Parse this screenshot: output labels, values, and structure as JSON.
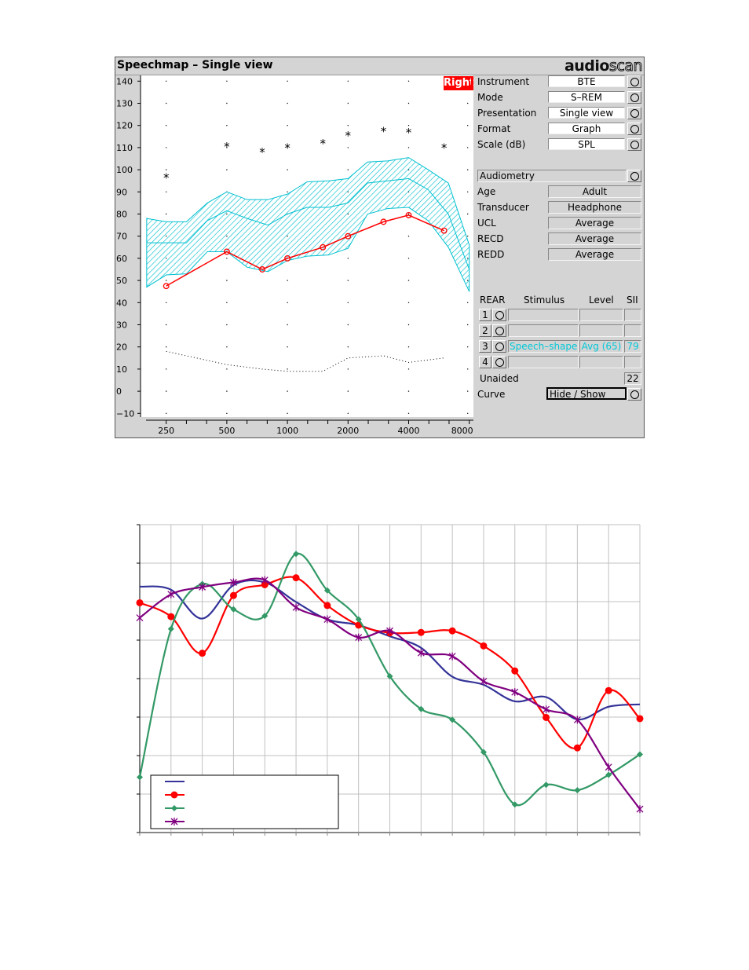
{
  "speechmap": {
    "title": "Speechmap – Single view",
    "brand_left": "audio",
    "brand_right": "scan",
    "ear_badge": "Right",
    "settings": [
      {
        "label": "Instrument",
        "value": "BTE"
      },
      {
        "label": "Mode",
        "value": "S–REM"
      },
      {
        "label": "Presentation",
        "value": "Single view"
      },
      {
        "label": "Format",
        "value": "Graph"
      },
      {
        "label": "Scale (dB)",
        "value": "SPL"
      }
    ],
    "audiometry": {
      "button": "Audiometry",
      "rows": [
        {
          "label": "Age",
          "value": "Adult"
        },
        {
          "label": "Transducer",
          "value": "Headphone"
        },
        {
          "label": "UCL",
          "value": "Average"
        },
        {
          "label": "RECD",
          "value": "Average"
        },
        {
          "label": "REDD",
          "value": "Average"
        }
      ]
    },
    "rear": {
      "headers": [
        "REAR",
        "Stimulus",
        "Level",
        "SII"
      ],
      "rows": [
        {
          "num": "1",
          "stimulus": "",
          "level": "",
          "sii": ""
        },
        {
          "num": "2",
          "stimulus": "",
          "level": "",
          "sii": ""
        },
        {
          "num": "3",
          "stimulus": "Speech–shape",
          "level": "Avg (65)",
          "sii": "79"
        },
        {
          "num": "4",
          "stimulus": "",
          "level": "",
          "sii": ""
        }
      ],
      "unaided_label": "Unaided",
      "unaided_value": "22",
      "curve_label": "Curve",
      "curve_button": "Hide / Show"
    },
    "colors": {
      "ear": "#ff0000",
      "speech_band": "#00c0d0",
      "aided": "#ff0000"
    }
  },
  "chart_data": [
    {
      "type": "line",
      "xscale": "log",
      "xlim": [
        200,
        8000
      ],
      "ylim": [
        -10,
        140
      ],
      "ylabel": "",
      "xlabel": "",
      "y_ticks": [
        "140",
        "130",
        "120",
        "110",
        "100",
        "90",
        "80",
        "70",
        "60",
        "50",
        "40",
        "30",
        "20",
        "10",
        "0",
        "−10"
      ],
      "x_ticks": [
        "250",
        "500",
        "1000",
        "2000",
        "4000",
        "8000"
      ],
      "grid": "dots",
      "aided_output": {
        "x": [
          250,
          500,
          750,
          1000,
          1500,
          2000,
          3000,
          4000,
          6000
        ],
        "y": [
          47.5,
          63,
          55,
          60,
          65,
          70,
          76.5,
          79.5,
          72.5
        ]
      },
      "ucl": {
        "x": [
          250,
          500,
          750,
          1000,
          1500,
          2000,
          3000,
          4000,
          6000
        ],
        "y": [
          97,
          111,
          108.5,
          110.5,
          112.5,
          116,
          118,
          117.5,
          110.5
        ]
      },
      "threshold": {
        "x": [
          250,
          500,
          750,
          1000,
          1500,
          2000,
          3000,
          4000,
          6000
        ],
        "y": [
          18,
          12,
          10,
          9,
          9,
          15,
          16,
          13,
          15
        ]
      },
      "speech_band": {
        "x": [
          200,
          250,
          315,
          400,
          500,
          630,
          800,
          1000,
          1250,
          1600,
          2000,
          2500,
          3150,
          4000,
          5000,
          6300,
          8000
        ],
        "upper": [
          78,
          76.5,
          76.5,
          85,
          90,
          86.5,
          86.5,
          89,
          94.5,
          95,
          96,
          103.5,
          104,
          105.5,
          100,
          94,
          66
        ],
        "middle": [
          67,
          67,
          67,
          77,
          81.5,
          78,
          75,
          80,
          83,
          83,
          85,
          94,
          95,
          96,
          91,
          80,
          55
        ],
        "lower": [
          47,
          52.5,
          53,
          63,
          63,
          56,
          54,
          59,
          61,
          61.5,
          64.5,
          80,
          82.5,
          83,
          77,
          65,
          45
        ]
      }
    },
    {
      "type": "line",
      "x": [
        0,
        1,
        2,
        3,
        4,
        5,
        6,
        7,
        8,
        9,
        10,
        11,
        12,
        13,
        14,
        15,
        16
      ],
      "ylim": [
        0,
        8
      ],
      "grid": true,
      "legend": "bottom-left",
      "series": [
        {
          "color": "#333399",
          "marker": "none",
          "values": [
            6.39,
            6.31,
            5.56,
            6.43,
            6.5,
            5.99,
            5.54,
            5.39,
            5.1,
            4.8,
            4.05,
            3.84,
            3.41,
            3.52,
            2.94,
            3.27,
            3.33
          ]
        },
        {
          "color": "#ff0000",
          "marker": "circle",
          "values": [
            5.97,
            5.61,
            4.66,
            6.16,
            6.44,
            6.62,
            5.9,
            5.39,
            5.19,
            5.2,
            5.24,
            4.85,
            4.2,
            2.99,
            2.2,
            3.69,
            2.96
          ]
        },
        {
          "color": "#339966",
          "marker": "diamond",
          "values": [
            1.44,
            5.29,
            6.46,
            5.8,
            5.63,
            7.24,
            6.29,
            5.54,
            4.06,
            3.21,
            2.93,
            2.09,
            0.73,
            1.24,
            1.1,
            1.5,
            2.03
          ]
        },
        {
          "color": "#800080",
          "marker": "asterisk",
          "values": [
            5.58,
            6.19,
            6.38,
            6.5,
            6.56,
            5.85,
            5.54,
            5.07,
            5.24,
            4.67,
            4.58,
            3.93,
            3.65,
            3.2,
            2.93,
            1.7,
            0.61
          ]
        }
      ]
    }
  ]
}
